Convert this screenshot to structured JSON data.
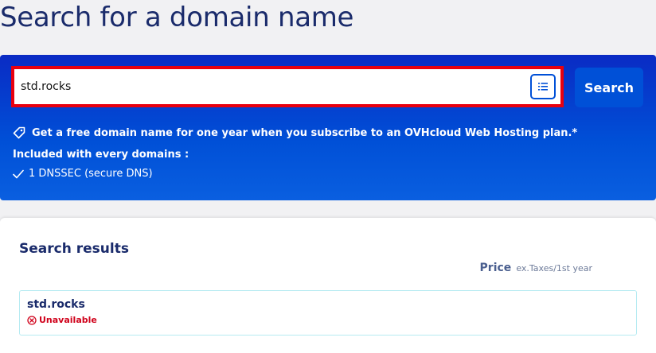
{
  "page": {
    "title": "Search for a domain name"
  },
  "search": {
    "value": "std.rocks",
    "button_label": "Search"
  },
  "promo": {
    "text": "Get a free domain name for one year when you subscribe to an OVHcloud Web Hosting plan.*"
  },
  "included": {
    "heading": "Included with every domains :",
    "features": [
      "1 DNSSEC (secure DNS)"
    ]
  },
  "results": {
    "title": "Search results",
    "price_label": "Price",
    "price_note": "ex.Taxes/1st year",
    "items": [
      {
        "domain": "std.rocks",
        "status": "Unavailable"
      }
    ]
  },
  "colors": {
    "brand_blue": "#0050d7",
    "title_navy": "#1a2b6b",
    "error_red": "#d0021b",
    "focus_border": "#e8000f"
  },
  "icons": {
    "list": "list-icon",
    "tag": "tag-icon",
    "check": "check-icon",
    "unavailable": "circle-x-icon"
  }
}
